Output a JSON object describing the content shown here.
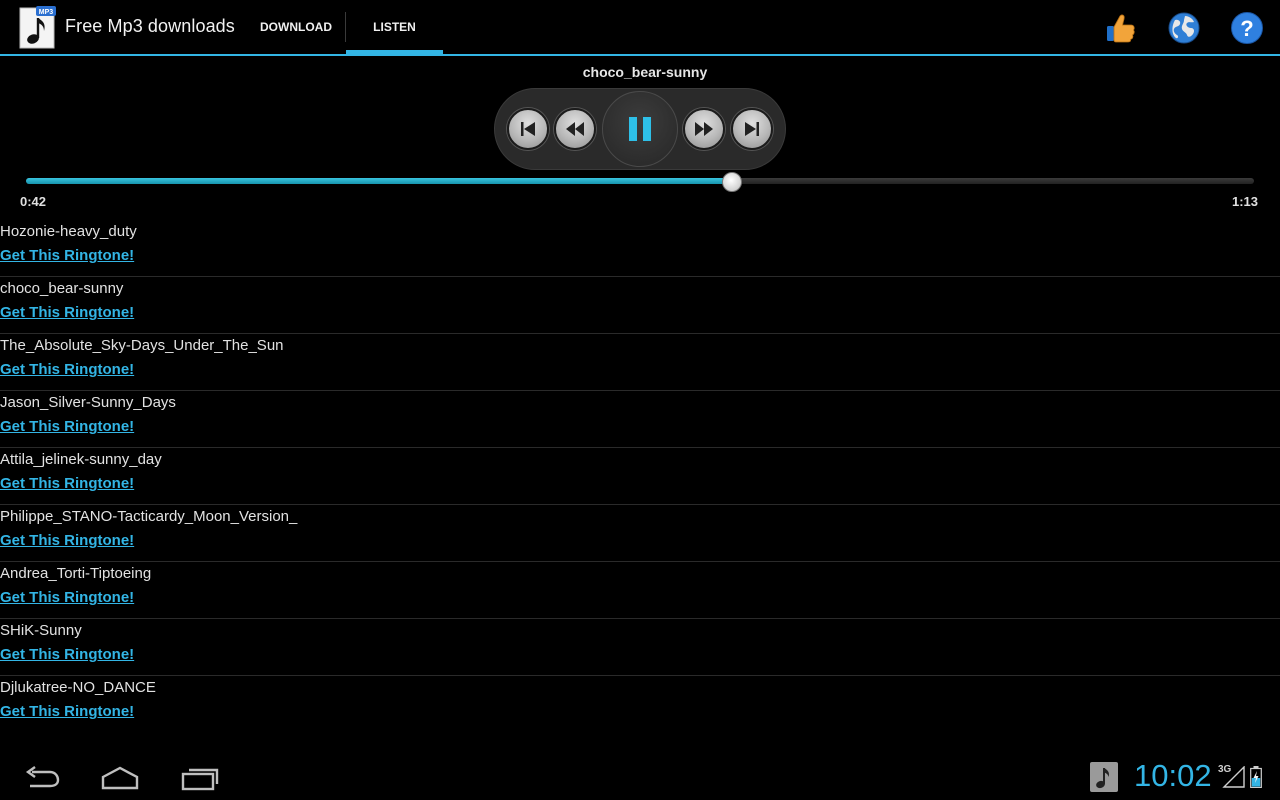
{
  "app": {
    "title": "Free Mp3 downloads",
    "icon_badge": "MP3"
  },
  "tabs": [
    {
      "label": "DOWNLOAD",
      "selected": false
    },
    {
      "label": "LISTEN",
      "selected": true
    }
  ],
  "actions": {
    "icons": [
      "thumbs-up-icon",
      "globe-icon",
      "help-icon"
    ]
  },
  "player": {
    "now_playing": "choco_bear-sunny",
    "current_time": "0:42",
    "total_time": "1:13",
    "progress_fraction": 0.575,
    "state": "playing"
  },
  "list": [
    {
      "name": "Hozonie-heavy_duty",
      "link": "Get This Ringtone!"
    },
    {
      "name": "choco_bear-sunny",
      "link": "Get This Ringtone!"
    },
    {
      "name": "The_Absolute_Sky-Days_Under_The_Sun",
      "link": "Get This Ringtone!"
    },
    {
      "name": "Jason_Silver-Sunny_Days",
      "link": "Get This Ringtone!"
    },
    {
      "name": "Attila_jelinek-sunny_day",
      "link": "Get This Ringtone!"
    },
    {
      "name": "Philippe_STANO-Tacticardy_Moon_Version_",
      "link": "Get This Ringtone!"
    },
    {
      "name": "Andrea_Torti-Tiptoeing",
      "link": "Get This Ringtone!"
    },
    {
      "name": "SHiK-Sunny",
      "link": "Get This Ringtone!"
    },
    {
      "name": "Djlukatree-NO_DANCE",
      "link": "Get This Ringtone!"
    }
  ],
  "status": {
    "clock": "10:02",
    "network": "3G"
  },
  "colors": {
    "accent": "#33b5e5",
    "background": "#000000"
  }
}
